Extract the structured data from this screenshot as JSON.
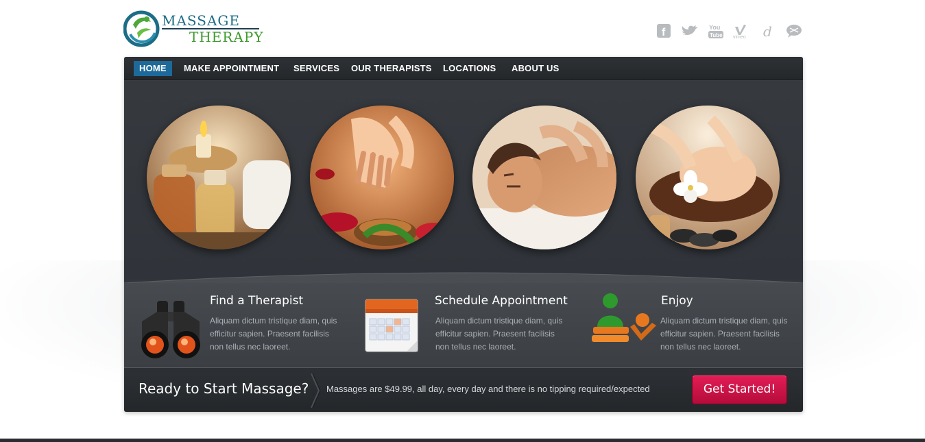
{
  "brand": {
    "line1": "MASSAGE",
    "line2": "THERAPY"
  },
  "socials": [
    {
      "icon": "facebook-icon",
      "label": "f"
    },
    {
      "icon": "twitter-icon",
      "label": ""
    },
    {
      "icon": "youtube-icon",
      "label": "You Tube"
    },
    {
      "icon": "vimeo-icon",
      "label": "vimeo"
    },
    {
      "icon": "delicious-icon",
      "label": "d"
    },
    {
      "icon": "chat-icon",
      "label": ""
    }
  ],
  "nav": {
    "items": [
      "HOME",
      "MAKE APPOINTMENT",
      "SERVICES",
      "OUR THERAPISTS",
      "LOCATIONS",
      "ABOUT US"
    ],
    "active": "HOME"
  },
  "hero": {
    "images": [
      "candles-oils-photo",
      "back-massage-photo",
      "man-massage-photo",
      "facial-massage-photo"
    ]
  },
  "features": [
    {
      "title": "Find a Therapist",
      "text": "Aliquam dictum tristique diam, quis efficitur sapien. Praesent facilisis non tellus nec laoreet.",
      "icon": "binoculars-icon"
    },
    {
      "title": "Schedule Appointment",
      "text": "Aliquam dictum tristique diam, quis efficitur sapien. Praesent facilisis non tellus nec laoreet.",
      "icon": "calendar-icon"
    },
    {
      "title": "Enjoy",
      "text": "Aliquam dictum tristique diam, quis efficitur sapien. Praesent facilisis non tellus nec laoreet.",
      "icon": "relax-icon"
    }
  ],
  "cta": {
    "title": "Ready to Start Massage?",
    "text": "Massages are $49.99, all day, every day and there is no tipping required/expected",
    "button": "Get Started!"
  },
  "colors": {
    "accent_blue": "#1d6a9a",
    "cta_red": "#d0164a",
    "panel_dark": "#33373c",
    "logo_blue": "#1c6d86",
    "logo_green": "#3e9b2f"
  }
}
